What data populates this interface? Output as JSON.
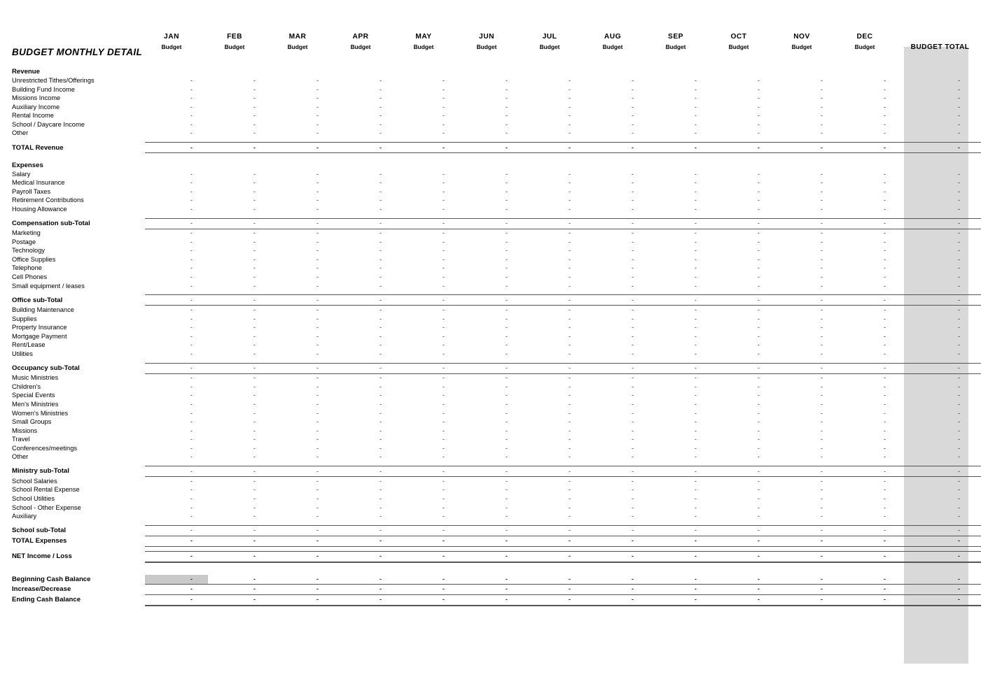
{
  "document": {
    "title": "BUDGET MONTHLY DETAIL"
  },
  "colors": {
    "total_column_highlight": "#d9d9d9",
    "cell_highlight": "#c9c9c9",
    "rule_line": "#555555",
    "text": "#000000"
  },
  "columns": {
    "row_label_header": "",
    "months": [
      {
        "name": "JAN",
        "sub": "Budget"
      },
      {
        "name": "FEB",
        "sub": "Budget"
      },
      {
        "name": "MAR",
        "sub": "Budget"
      },
      {
        "name": "APR",
        "sub": "Budget"
      },
      {
        "name": "MAY",
        "sub": "Budget"
      },
      {
        "name": "JUN",
        "sub": "Budget"
      },
      {
        "name": "JUL",
        "sub": "Budget"
      },
      {
        "name": "AUG",
        "sub": "Budget"
      },
      {
        "name": "SEP",
        "sub": "Budget"
      },
      {
        "name": "OCT",
        "sub": "Budget"
      },
      {
        "name": "NOV",
        "sub": "Budget"
      },
      {
        "name": "DEC",
        "sub": "Budget"
      }
    ],
    "total_header": "BUDGET TOTAL"
  },
  "empty_value": "-",
  "sections": {
    "revenue_header": "Revenue",
    "revenue_rows": [
      "Unrestricted Tithes/Offerings",
      "Building Fund Income",
      "Missions Income",
      "Auxiliary Income",
      "Rental Income",
      "School / Daycare Income",
      "Other"
    ],
    "revenue_total": "TOTAL Revenue",
    "expenses_header": "Expenses",
    "compensation_rows": [
      "Salary",
      "Medical Insurance",
      "Payroll Taxes",
      "Retirement Contributions",
      "Housing Allowance"
    ],
    "compensation_subtotal": "Compensation sub-Total",
    "office_rows": [
      "Marketing",
      "Postage",
      "Technology",
      "Office Supplies",
      "Telephone",
      "Cell Phones",
      "Small equipment / leases"
    ],
    "office_subtotal": "Office sub-Total",
    "occupancy_rows": [
      "Building Maintenance",
      "Supplies",
      "Property Insurance",
      "Mortgage Payment",
      "Rent/Lease",
      "Utilities"
    ],
    "occupancy_subtotal": "Occupancy sub-Total",
    "ministry_rows": [
      "Music Ministries",
      "Children's",
      "Special Events",
      "Men's Ministries",
      "Women's Ministries",
      "Small Groups",
      "Missions",
      "Travel",
      "Conferences/meetings",
      "Other"
    ],
    "ministry_subtotal": "Ministry sub-Total",
    "school_rows": [
      "School Salaries",
      "School Rental Expense",
      "School Utilities",
      "School - Other Expense",
      "Auxiliary"
    ],
    "school_subtotal": "School sub-Total",
    "expenses_total": "TOTAL Expenses",
    "net_income": "NET Income / Loss",
    "beginning_cash_balance": "Beginning Cash Balance",
    "increase_decrease": "Increase/Decrease",
    "ending_cash_balance": "Ending Cash Balance"
  }
}
